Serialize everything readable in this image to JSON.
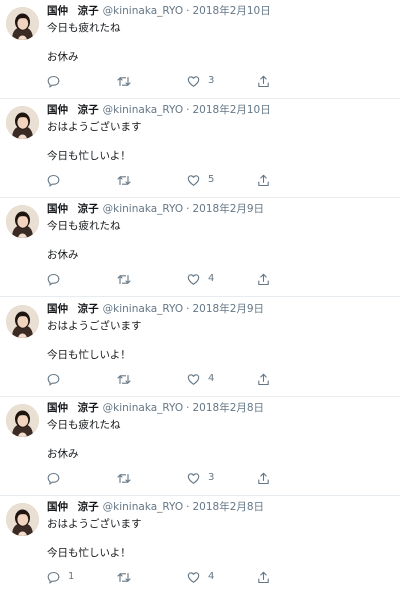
{
  "tweets": [
    {
      "name": "国仲 涼子",
      "handle": "@kininaka_RYO",
      "separator": "·",
      "date": "2018年2月10日",
      "line1": "今日も疲れたね",
      "line2": "お休み",
      "replies": "",
      "retweets": "",
      "likes": "3"
    },
    {
      "name": "国仲 涼子",
      "handle": "@kininaka_RYO",
      "separator": "·",
      "date": "2018年2月10日",
      "line1": "おはようございます",
      "line2": "今日も忙しいよ！",
      "replies": "",
      "retweets": "",
      "likes": "5"
    },
    {
      "name": "国仲 涼子",
      "handle": "@kininaka_RYO",
      "separator": "·",
      "date": "2018年2月9日",
      "line1": "今日も疲れたね",
      "line2": "お休み",
      "replies": "",
      "retweets": "",
      "likes": "4"
    },
    {
      "name": "国仲 涼子",
      "handle": "@kininaka_RYO",
      "separator": "·",
      "date": "2018年2月9日",
      "line1": "おはようございます",
      "line2": "今日も忙しいよ！",
      "replies": "",
      "retweets": "",
      "likes": "4"
    },
    {
      "name": "国仲 涼子",
      "handle": "@kininaka_RYO",
      "separator": "·",
      "date": "2018年2月8日",
      "line1": "今日も疲れたね",
      "line2": "お休み",
      "replies": "",
      "retweets": "",
      "likes": "3"
    },
    {
      "name": "国仲 涼子",
      "handle": "@kininaka_RYO",
      "separator": "·",
      "date": "2018年2月8日",
      "line1": "おはようございます",
      "line2": "今日も忙しいよ！",
      "replies": "1",
      "retweets": "",
      "likes": "4"
    }
  ],
  "icons": {
    "reply": "reply-icon",
    "retweet": "retweet-icon",
    "like": "heart-icon",
    "share": "share-icon",
    "avatar": "avatar"
  },
  "colors": {
    "icon": "#657786",
    "text": "#14171a",
    "divider": "#e6ecf0"
  }
}
